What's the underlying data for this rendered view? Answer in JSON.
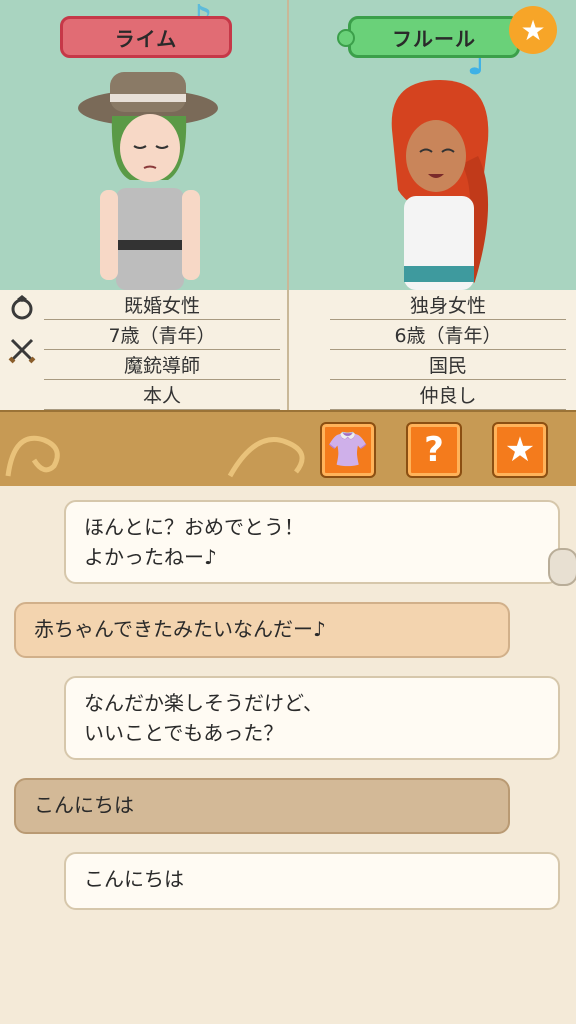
{
  "left_character": {
    "name": "ライム",
    "status": "既婚女性",
    "age": "7歳（青年）",
    "job": "魔銃導師",
    "relation": "本人"
  },
  "right_character": {
    "name": "フルール",
    "status": "独身女性",
    "age": "6歳（青年）",
    "job": "国民",
    "relation": "仲良し"
  },
  "toolbar": {
    "buttons": [
      "outfit-icon",
      "help-icon",
      "star-icon"
    ]
  },
  "chat": {
    "messages": [
      {
        "speaker": "right",
        "text1": "ほんとに？おめでとう！",
        "text2": "よかったねー♪"
      },
      {
        "speaker": "left",
        "text1": "赤ちゃんできたみたいなんだー♪"
      },
      {
        "speaker": "right",
        "text1": "なんだか楽しそうだけど、",
        "text2": "いいことでもあった？"
      },
      {
        "speaker": "left",
        "text1": "こんにちは"
      },
      {
        "speaker": "right",
        "text1": "こんにちは"
      }
    ]
  },
  "colors": {
    "top_bg": "#a9d4c0",
    "left_name_bg": "#e16c74",
    "right_name_bg": "#6ad179",
    "toolbar_bg": "#c79a54",
    "button_orange": "#f47b1c"
  }
}
